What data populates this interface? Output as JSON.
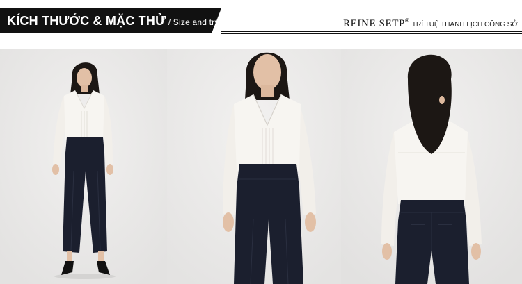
{
  "header": {
    "title": "KÍCH THƯỚC & MẶC THỬ",
    "subtitle": " / Size and try",
    "brand": "REINE SETP",
    "brand_mark": "®",
    "tagline": "TRÍ TUỆ THANH LỊCH CÔNG SỞ"
  },
  "colors": {
    "banner": "#111111",
    "blouse": "#f7f5f1",
    "trousers": "#1b1f2e",
    "hair": "#1c1714",
    "skin": "#e2c0a6",
    "background": "#ebeae9"
  },
  "photos": [
    {
      "view": "full-body-front"
    },
    {
      "view": "close-up-front"
    },
    {
      "view": "back"
    }
  ]
}
